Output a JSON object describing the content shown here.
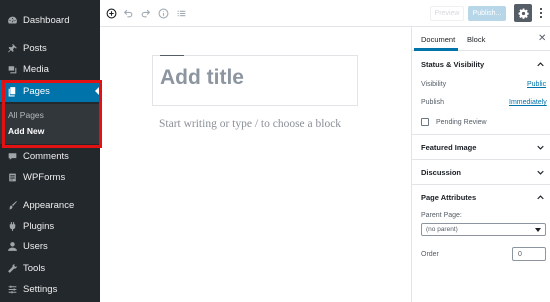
{
  "admin_menu": {
    "items": [
      {
        "label": "Dashboard",
        "icon": "dashboard-icon"
      },
      {
        "label": "Posts",
        "icon": "pushpin-icon"
      },
      {
        "label": "Media",
        "icon": "media-icon"
      },
      {
        "label": "Pages",
        "icon": "pages-icon",
        "active": true
      },
      {
        "label": "Comments",
        "icon": "comments-icon"
      },
      {
        "label": "WPForms",
        "icon": "forms-icon"
      },
      {
        "label": "Appearance",
        "icon": "paintbrush-icon"
      },
      {
        "label": "Plugins",
        "icon": "plug-icon"
      },
      {
        "label": "Users",
        "icon": "users-icon"
      },
      {
        "label": "Tools",
        "icon": "wrench-icon"
      },
      {
        "label": "Settings",
        "icon": "sliders-icon"
      }
    ],
    "pages_submenu": [
      {
        "label": "All Pages"
      },
      {
        "label": "Add New",
        "current": true
      }
    ]
  },
  "toolbar": {
    "tools": [
      "add-block-icon",
      "undo-icon",
      "redo-icon",
      "info-icon",
      "block-navigation-icon"
    ],
    "preview_label": "Preview",
    "publish_label": "Publish...",
    "settings_icon": "gear-icon",
    "more_icon": "more-vertical-icon"
  },
  "editor": {
    "title_placeholder": "Add title",
    "block_placeholder": "Start writing or type / to choose a block"
  },
  "settings_panel": {
    "tabs": {
      "document": "Document",
      "block": "Block"
    },
    "close_icon": "close-icon",
    "status_visibility": {
      "heading": "Status & Visibility",
      "visibility_label": "Visibility",
      "visibility_value": "Public",
      "publish_label": "Publish",
      "publish_value": "Immediately",
      "pending_review_label": "Pending Review"
    },
    "featured_image": {
      "heading": "Featured Image"
    },
    "discussion": {
      "heading": "Discussion"
    },
    "page_attributes": {
      "heading": "Page Attributes",
      "parent_label": "Parent Page:",
      "parent_value": "(no parent)",
      "order_label": "Order",
      "order_value": "0"
    }
  },
  "colors": {
    "sidebar_bg": "#23282d",
    "active_blue": "#0073aa",
    "highlight_red": "#e31212"
  }
}
